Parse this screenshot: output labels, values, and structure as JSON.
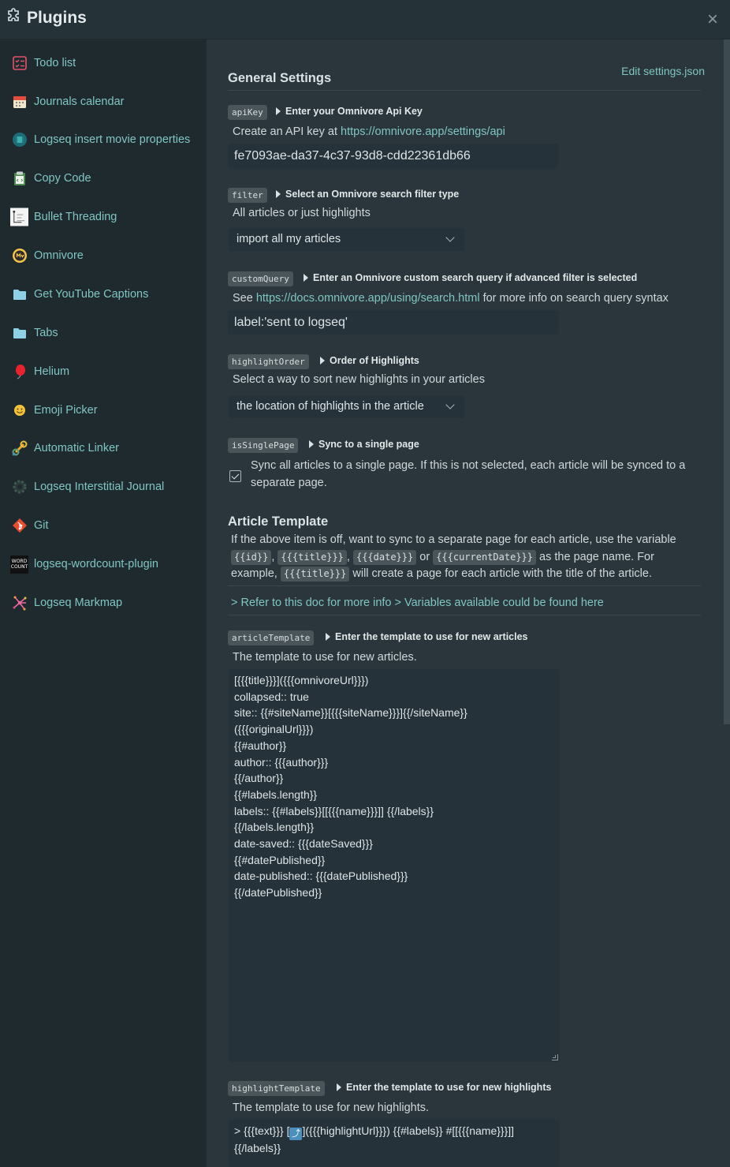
{
  "header": {
    "title": "Plugins",
    "close_label": "×"
  },
  "sidebar": {
    "items": [
      {
        "label": "Todo list",
        "icon": "todo-list-icon"
      },
      {
        "label": "Journals calendar",
        "icon": "calendar-icon"
      },
      {
        "label": "Logseq insert movie properties",
        "icon": "movie-icon"
      },
      {
        "label": "Copy Code",
        "icon": "clipboard-icon"
      },
      {
        "label": "Bullet Threading",
        "icon": "bullet-threading-icon"
      },
      {
        "label": "Omnivore",
        "icon": "omnivore-icon"
      },
      {
        "label": "Get YouTube Captions",
        "icon": "folder-icon"
      },
      {
        "label": "Tabs",
        "icon": "folder-icon"
      },
      {
        "label": "Helium",
        "icon": "balloon-icon"
      },
      {
        "label": "Emoji Picker",
        "icon": "emoji-icon"
      },
      {
        "label": "Automatic Linker",
        "icon": "linker-icon"
      },
      {
        "label": "Logseq Interstitial Journal",
        "icon": "gear-icon"
      },
      {
        "label": "Git",
        "icon": "git-icon"
      },
      {
        "label": "logseq-wordcount-plugin",
        "icon": "wordcount-icon",
        "icon_text": "WORD COUNT"
      },
      {
        "label": "Logseq Markmap",
        "icon": "markmap-icon"
      }
    ]
  },
  "main": {
    "general_title": "General Settings",
    "edit_link": "Edit settings.json",
    "apiKey": {
      "key": "apiKey",
      "title": "Enter your Omnivore Api Key",
      "desc_prefix": "Create an API key at ",
      "desc_link": "https://omnivore.app/settings/api",
      "value": "fe7093ae-da37-4c37-93d8-cdd22361db66"
    },
    "filter": {
      "key": "filter",
      "title": "Select an Omnivore search filter type",
      "desc": "All articles or just highlights",
      "value": "import all my articles"
    },
    "customQuery": {
      "key": "customQuery",
      "title": "Enter an Omnivore custom search query if advanced filter is selected",
      "desc_prefix": "See ",
      "desc_link": "https://docs.omnivore.app/using/search.html",
      "desc_suffix": " for more info on search query syntax",
      "value": "label:'sent to logseq'"
    },
    "highlightOrder": {
      "key": "highlightOrder",
      "title": "Order of Highlights",
      "desc": "Select a way to sort new highlights in your articles",
      "value": "the location of highlights in the article"
    },
    "isSinglePage": {
      "key": "isSinglePage",
      "title": "Sync to a single page",
      "desc_line1": "Sync all articles to a single page. If this is not selected, each article will be synced to a",
      "desc_line2": "separate page.",
      "checked": true
    },
    "article_template_section": {
      "title": "Article Template",
      "p1": "If the above item is off, want to sync to a separate page for each article, use the variable",
      "code_id": "{{id}}",
      "code_title": "{{{title}}}",
      "code_date": "{{{date}}}",
      "or": "or",
      "code_currentDate": "{{{currentDate}}}",
      "p2_suffix": "as the page name. For",
      "p3_prefix": "example,",
      "code_title2": "{{{title}}}",
      "p3_suffix": "will create a page for each article with the title of the article.",
      "doc_link": "> Refer to this doc for more info > Variables available could be found here"
    },
    "articleTemplate": {
      "key": "articleTemplate",
      "title": "Enter the template to use for new articles",
      "desc": "The template to use for new articles.",
      "lines": [
        "[{{{title}}}]({{{omnivoreUrl}}})",
        "collapsed:: true",
        "site:: {{#siteName}}[{{{siteName}}}]{{/siteName}}",
        "({{{originalUrl}}})",
        "{{#author}}",
        "author:: {{{author}}}",
        "{{/author}}",
        "{{#labels.length}}",
        "labels:: {{#labels}}[[{{{name}}}]] {{/labels}}",
        "{{/labels.length}}",
        "date-saved:: {{{dateSaved}}}",
        "{{#datePublished}}",
        "date-published:: {{{datePublished}}}",
        "{{/datePublished}}"
      ]
    },
    "highlightTemplate": {
      "key": "highlightTemplate",
      "title": "Enter the template to use for new highlights",
      "desc": "The template to use for new highlights.",
      "line1_prefix": "> {{{text}}} [",
      "line1_emoji": "⤴",
      "line1_suffix": "]({{{highlightUrl}}}) {{#labels}} #[[{{{name}}}]]",
      "line2": "{{/labels}}"
    }
  }
}
